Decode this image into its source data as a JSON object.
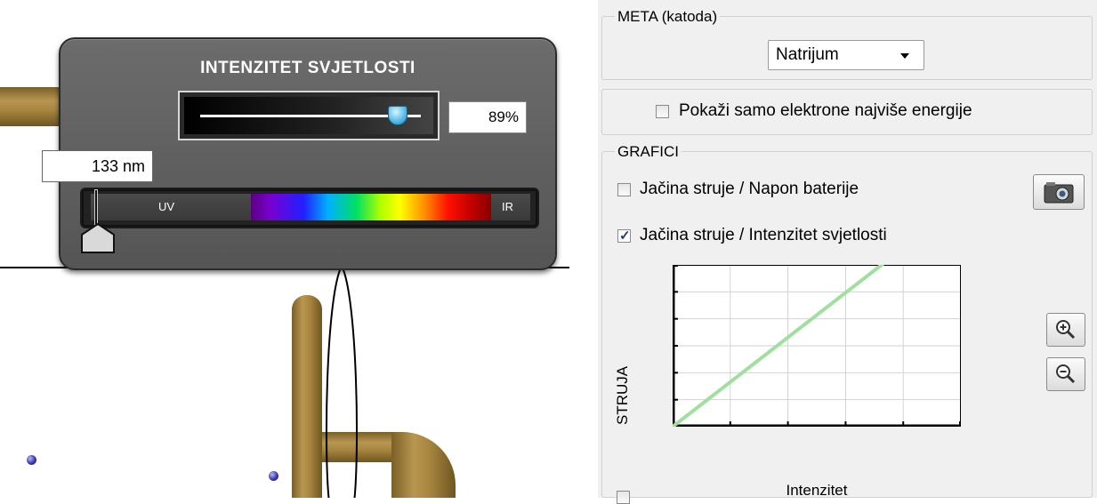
{
  "light": {
    "title": "INTENZITET SVJETLOSTI",
    "intensity_text": "89%",
    "intensity_value": 0.89,
    "wavelength_text": "133 nm",
    "uv_label": "UV",
    "ir_label": "IR"
  },
  "panel": {
    "target_group_label": "META (katoda)",
    "target_selected": "Natrijum",
    "show_high_energy_label": "Pokaži samo elektrone najviše energije",
    "show_high_energy_checked": false,
    "graphs_group_label": "GRAFICI",
    "graph_current_voltage_label": "Jačina struje / Napon baterije",
    "graph_current_voltage_checked": false,
    "graph_current_intensity_label": "Jačina struje / Intenzitet svjetlosti",
    "graph_current_intensity_checked": true
  },
  "chart_data": {
    "type": "line",
    "xlabel": "Intenzitet",
    "ylabel": "STRUJA",
    "xlim": [
      0,
      1
    ],
    "ylim": [
      0,
      1
    ],
    "grid": true,
    "series": [
      {
        "color": "#9fe09f",
        "x": [
          0,
          1
        ],
        "y": [
          0,
          1.38
        ]
      }
    ]
  }
}
